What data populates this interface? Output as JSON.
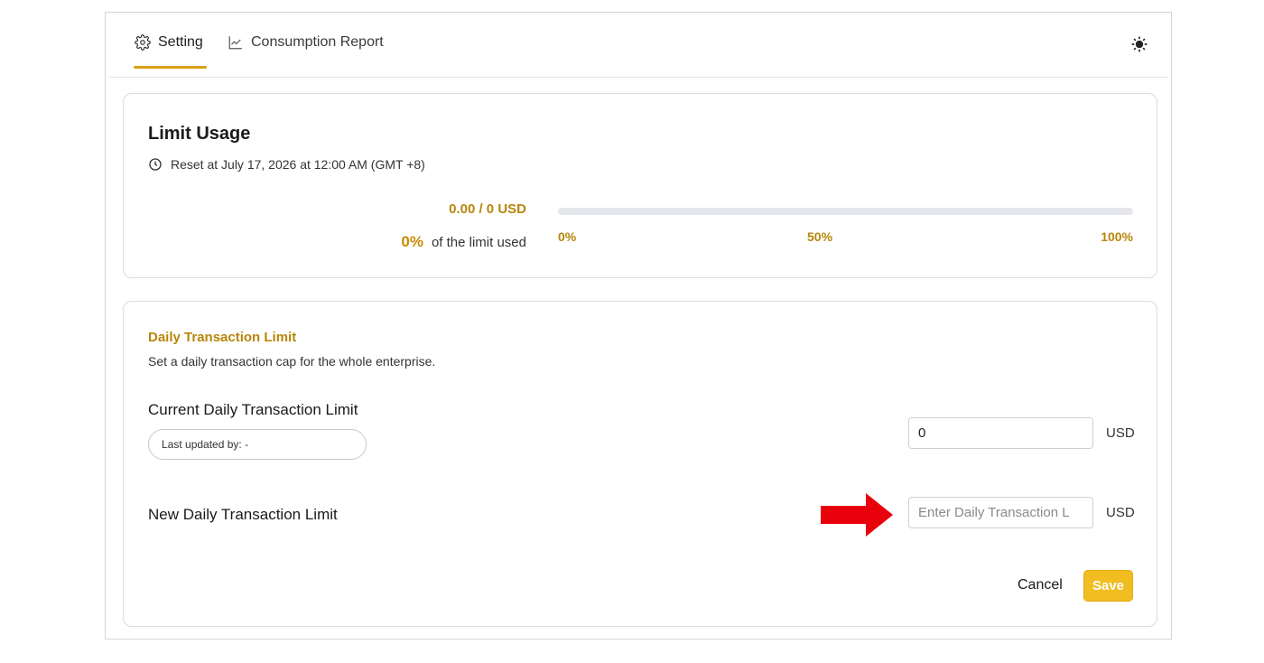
{
  "tabs": [
    {
      "label": "Setting",
      "icon": "gear-icon",
      "active": true
    },
    {
      "label": "Consumption Report",
      "icon": "line-chart-icon",
      "active": false
    }
  ],
  "theme_toggle": {
    "icon": "sun-icon"
  },
  "limit_usage": {
    "title": "Limit Usage",
    "reset_text": "Reset at July 17, 2026 at 12:00 AM (GMT +8)",
    "amount": "0.00 / 0 USD",
    "percent": "0%",
    "percent_suffix": "of the limit used",
    "progress_fraction": 0,
    "ticks": [
      "0%",
      "50%",
      "100%"
    ]
  },
  "daily_limit": {
    "title": "Daily Transaction Limit",
    "description": "Set a daily transaction cap for the whole enterprise.",
    "current_label": "Current Daily Transaction Limit",
    "last_updated": "Last updated by: -",
    "current_value": "0",
    "currency": "USD",
    "new_label": "New Daily Transaction Limit",
    "new_placeholder": "Enter Daily Transaction L",
    "new_value": "",
    "cancel_label": "Cancel",
    "save_label": "Save"
  },
  "colors": {
    "accent": "#d9a016",
    "accent_text": "#b8860b",
    "save_button": "#f1bd20",
    "annotation_arrow": "#e8000b"
  }
}
